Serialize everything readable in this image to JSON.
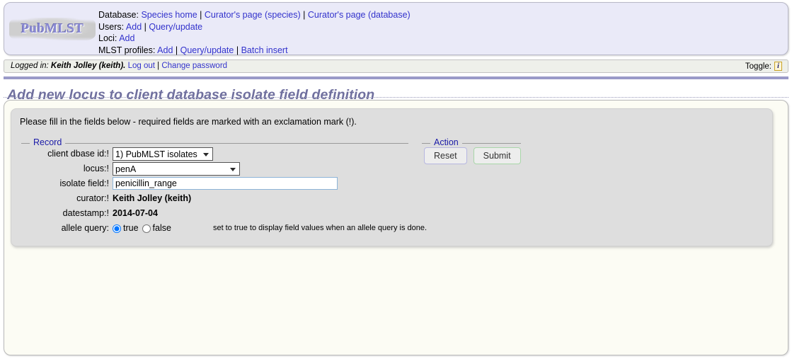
{
  "site": {
    "logo_text": "PubMLST"
  },
  "header_nav": {
    "rows": [
      {
        "label": "Database:",
        "links": [
          "Species home",
          "Curator's page (species)",
          "Curator's page (database)"
        ]
      },
      {
        "label": "Users:",
        "links": [
          "Add",
          "Query/update"
        ]
      },
      {
        "label": "Loci:",
        "links": [
          "Add"
        ]
      },
      {
        "label": "MLST profiles:",
        "links": [
          "Add",
          "Query/update",
          "Batch insert"
        ]
      }
    ]
  },
  "auth_bar": {
    "logged_in_label": "Logged in:",
    "user": "Keith Jolley (keith).",
    "log_out": "Log out",
    "separator": "|",
    "change_password": "Change password",
    "toggle_label": "Toggle:",
    "toggle_icon": "info-icon",
    "toggle_icon_glyph": "i"
  },
  "page": {
    "title": "Add new locus to client database isolate field definition"
  },
  "form": {
    "intro": "Please fill in the fields below - required fields are marked with an exclamation mark (!).",
    "record_legend": "Record",
    "action_legend": "Action",
    "fields": {
      "client_dbase_id": {
        "label": "client dbase id:!",
        "value": "1) PubMLST isolates",
        "options": [
          "1) PubMLST isolates"
        ]
      },
      "locus": {
        "label": "locus:!",
        "value": "penA",
        "options": [
          "penA"
        ]
      },
      "isolate_field": {
        "label": "isolate field:!",
        "value": "penicillin_range",
        "placeholder": ""
      },
      "curator": {
        "label": "curator:!",
        "value": "Keith Jolley (keith)"
      },
      "datestamp": {
        "label": "datestamp:!",
        "value": "2014-07-04"
      },
      "allele_query": {
        "label": "allele query:",
        "option_true": "true",
        "option_false": "false",
        "selected": "true",
        "hint": "set to true to display field values when an allele query is done."
      }
    },
    "buttons": {
      "reset": "Reset",
      "submit": "Submit"
    }
  },
  "colors": {
    "header_bg": "#eaeaf8",
    "title_text": "#6f6f9e",
    "title_rule": "#9a9ac8",
    "link": "#3333cc",
    "legend": "#1a1aa8",
    "panel_bg": "#dedede",
    "card_bg": "#fcfcf4",
    "reset_border": "#b6b6e0",
    "submit_border": "#a9d6a9",
    "info_icon_bg": "#fcf5d8"
  }
}
